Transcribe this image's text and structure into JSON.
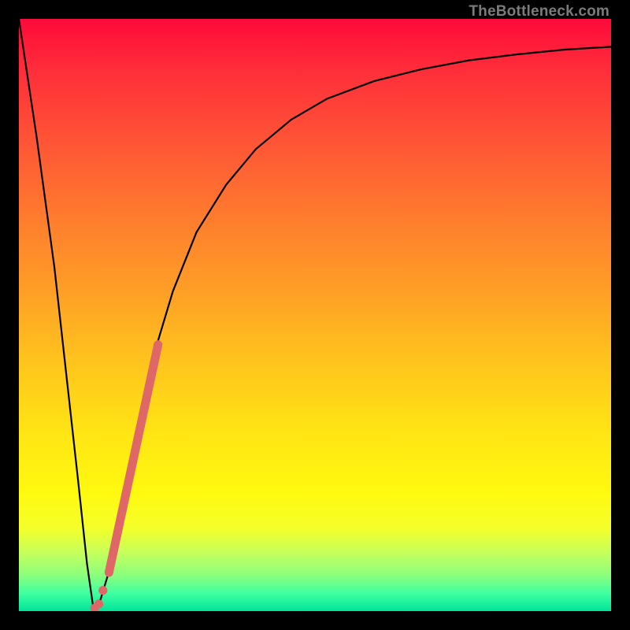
{
  "watermark": "TheBottleneck.com",
  "chart_data": {
    "type": "line",
    "title": "",
    "xlabel": "",
    "ylabel": "",
    "xlim": [
      0,
      100
    ],
    "ylim": [
      0,
      100
    ],
    "grid": false,
    "series": [
      {
        "name": "bottleneck-curve",
        "color": "#000000",
        "x": [
          0,
          3,
          6,
          8,
          10,
          11.5,
          12.5,
          13.5,
          15,
          17,
          19,
          21,
          23,
          26,
          30,
          35,
          40,
          46,
          52,
          60,
          68,
          76,
          84,
          92,
          100
        ],
        "y": [
          100,
          80,
          58,
          40,
          22,
          8,
          1,
          1,
          6,
          16,
          26,
          36,
          44,
          54,
          64,
          72,
          78,
          83,
          86.5,
          89.5,
          91.5,
          93,
          94,
          94.8,
          95.3
        ]
      }
    ],
    "markers": [
      {
        "name": "highlight-segment",
        "color": "#e06767",
        "type": "thick-line",
        "x": [
          15.2,
          23.5
        ],
        "y": [
          6.5,
          45.0
        ]
      },
      {
        "name": "highlight-dots",
        "color": "#e06767",
        "type": "dots",
        "points": [
          {
            "x": 14.2,
            "y": 3.5
          },
          {
            "x": 13.5,
            "y": 1.2
          },
          {
            "x": 12.8,
            "y": 0.5
          }
        ]
      }
    ]
  }
}
